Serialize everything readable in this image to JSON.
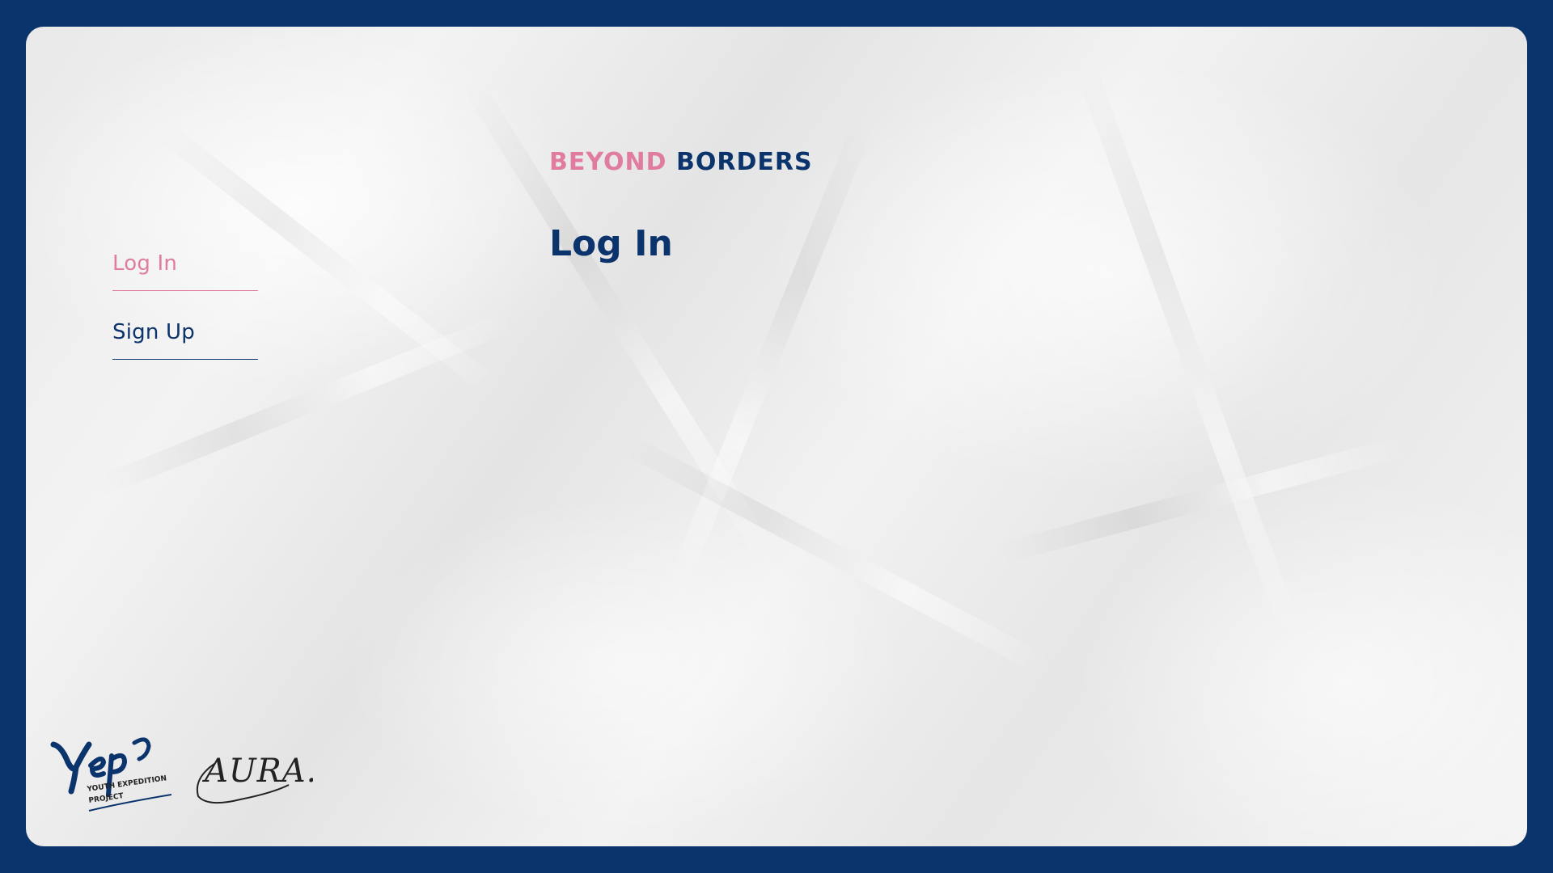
{
  "colors": {
    "background": "#0b346d",
    "accent": "#e07ca0",
    "primary": "#0b346d"
  },
  "nav": {
    "items": [
      {
        "label": "Log In",
        "state": "active"
      },
      {
        "label": "Sign Up",
        "state": "inactive"
      }
    ]
  },
  "brand": {
    "word1": "BEYOND",
    "word2": "BORDERS"
  },
  "main": {
    "title": "Log In"
  },
  "footer": {
    "logos": [
      {
        "name": "yep-logo",
        "text": "Yep YOUTH EXPEDITION PROJECT"
      },
      {
        "name": "aura-logo",
        "text": "AURA."
      }
    ]
  }
}
